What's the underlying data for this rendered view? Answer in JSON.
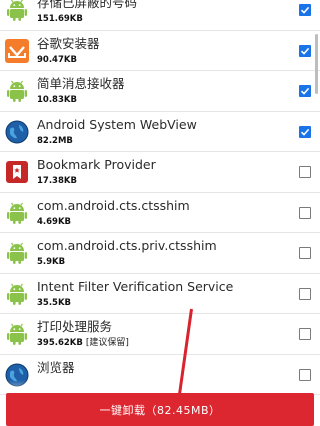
{
  "apps": [
    {
      "name": "存储已屏蔽的号码",
      "size": "151.69KB",
      "tag": "",
      "checked": true,
      "icon": "android-icon"
    },
    {
      "name": "谷歌安装器",
      "size": "90.47KB",
      "tag": "",
      "checked": true,
      "icon": "installer-icon"
    },
    {
      "name": "简单消息接收器",
      "size": "10.83KB",
      "tag": "",
      "checked": true,
      "icon": "android-icon"
    },
    {
      "name": "Android System WebView",
      "size": "82.2MB",
      "tag": "",
      "checked": true,
      "icon": "globe-icon"
    },
    {
      "name": "Bookmark Provider",
      "size": "17.38KB",
      "tag": "",
      "checked": false,
      "icon": "bookmark-icon"
    },
    {
      "name": "com.android.cts.ctsshim",
      "size": "4.69KB",
      "tag": "",
      "checked": false,
      "icon": "android-icon"
    },
    {
      "name": "com.android.cts.priv.ctsshim",
      "size": "5.9KB",
      "tag": "",
      "checked": false,
      "icon": "android-icon"
    },
    {
      "name": "Intent Filter Verification Service",
      "size": "35.5KB",
      "tag": "",
      "checked": false,
      "icon": "android-icon"
    },
    {
      "name": "打印处理服务",
      "size": "395.62KB",
      "tag": "[建议保留]",
      "checked": false,
      "icon": "android-icon"
    },
    {
      "name": "浏览器",
      "size": "",
      "tag": "",
      "checked": false,
      "icon": "globe-icon"
    }
  ],
  "uninstall_button": {
    "label": "一键卸载（82.45MB）"
  },
  "colors": {
    "accent": "#1a73e8",
    "danger": "#dc2630",
    "android": "#8bc34a"
  }
}
